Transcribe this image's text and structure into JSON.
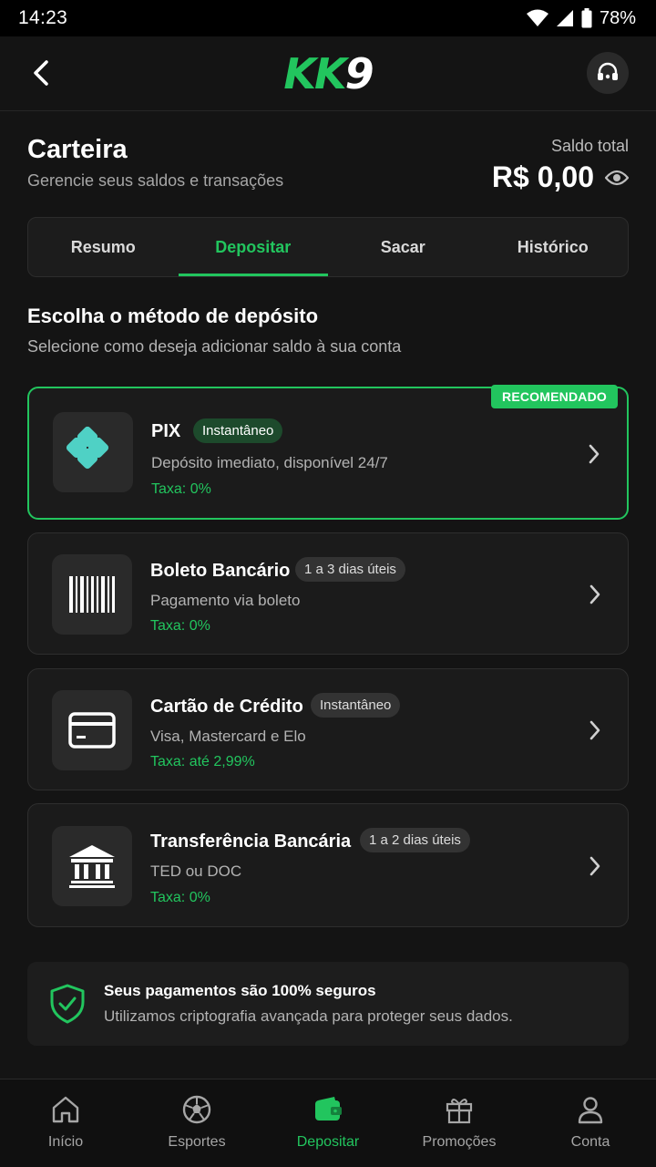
{
  "status_bar": {
    "time": "14:23",
    "battery": "78%"
  },
  "app": {
    "logo_kk": "KK",
    "logo_nine": "9"
  },
  "header": {
    "title": "Carteira",
    "subtitle": "Gerencie seus saldos e transações",
    "balance_label": "Saldo total",
    "balance_value": "R$ 0,00"
  },
  "tabs": [
    {
      "label": "Resumo"
    },
    {
      "label": "Depositar",
      "active": true
    },
    {
      "label": "Sacar"
    },
    {
      "label": "Histórico"
    }
  ],
  "section": {
    "title": "Escolha o método de depósito",
    "subtitle": "Selecione como deseja adicionar saldo à sua conta"
  },
  "methods": [
    {
      "name": "PIX",
      "badge": "Instantâneo",
      "desc": "Depósito imediato, disponível 24/7",
      "fee": "Taxa: 0%",
      "tag": "RECOMENDADO",
      "icon": "pix-icon"
    },
    {
      "name": "Boleto Bancário",
      "badge": "1 a 3 dias úteis",
      "desc": "Pagamento via boleto",
      "fee": "Taxa: 0%",
      "icon": "barcode-icon"
    },
    {
      "name": "Cartão de Crédito",
      "badge": "Instantâneo",
      "desc": "Visa, Mastercard e Elo",
      "fee": "Taxa: até 2,99%",
      "icon": "credit-card-icon"
    },
    {
      "name": "Transferência Bancária",
      "badge": "1 a 2 dias úteis",
      "desc": "TED ou DOC",
      "fee": "Taxa: 0%",
      "icon": "bank-icon"
    }
  ],
  "security": {
    "title": "Seus pagamentos são 100% seguros",
    "text": "Utilizamos criptografia avançada para proteger seus dados."
  },
  "nav": [
    {
      "label": "Início",
      "icon": "home-icon"
    },
    {
      "label": "Esportes",
      "icon": "soccer-ball-icon"
    },
    {
      "label": "Depositar",
      "icon": "wallet-icon",
      "active": true
    },
    {
      "label": "Promoções",
      "icon": "gift-icon"
    },
    {
      "label": "Conta",
      "icon": "user-icon"
    }
  ],
  "colors": {
    "accent": "#22c55e",
    "background": "#141414",
    "card": "#1b1b1b"
  }
}
